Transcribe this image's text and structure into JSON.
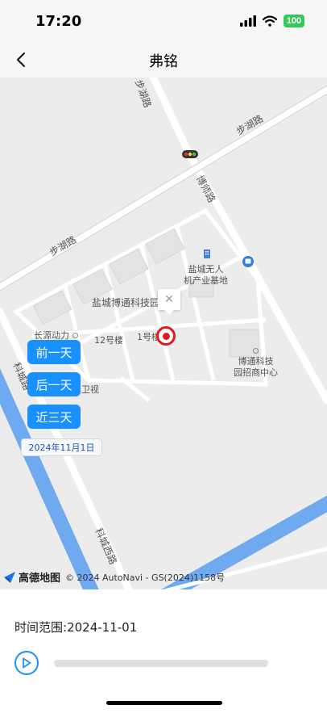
{
  "status_bar": {
    "time": "17:20",
    "battery": "100"
  },
  "nav": {
    "title": "弗铭"
  },
  "map": {
    "roads": [
      "步湖路",
      "步湖路",
      "博师路",
      "科城路",
      "科城西路"
    ],
    "pois": {
      "uav_base_line1": "盐城无人",
      "uav_base_line2": "机产业基地",
      "tech_park": "盐城博通科技园",
      "power": "长源动力",
      "building12": "12号楼",
      "building1": "1号楼",
      "weishi": "卫视",
      "recruit_line1": "博通科技",
      "recruit_line2": "园招商中心"
    },
    "buttons": {
      "prev_day": "前一天",
      "next_day": "后一天",
      "last_three_days": "近三天"
    },
    "current_date": "2024年11月1日",
    "info_close": "✕",
    "attribution": {
      "logo_text": "高德地图",
      "copyright": "© 2024 AutoNavi - GS(2024)1158号"
    }
  },
  "playback": {
    "label": "时间范围:",
    "value": "2024-11-01",
    "progress": 0
  },
  "colors": {
    "accent": "#1890ff",
    "marker": "#d81e1e",
    "water": "#6fa9f0"
  }
}
